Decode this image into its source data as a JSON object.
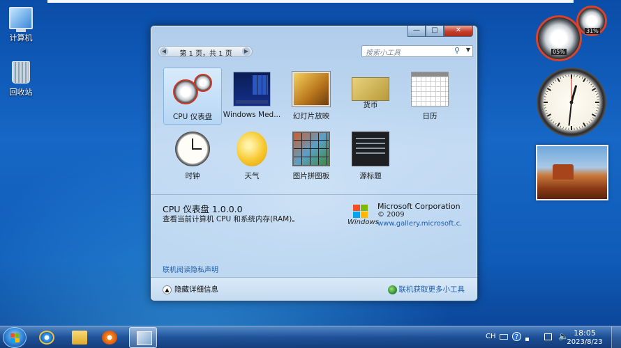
{
  "desktop": {
    "icons": [
      {
        "label": "计算机",
        "icon": "computer-icon"
      },
      {
        "label": "回收站",
        "icon": "recycle-bin-icon"
      }
    ]
  },
  "gadget_window": {
    "pager": {
      "text": "第 1 页，共 1 页",
      "prev": "◀",
      "next": "▶"
    },
    "search": {
      "placeholder": "搜索小工具",
      "icon": "search-icon"
    },
    "gadgets": [
      {
        "label": "CPU 仪表盘",
        "selected": true
      },
      {
        "label": "Windows Med...",
        "selected": false
      },
      {
        "label": "幻灯片放映",
        "selected": false
      },
      {
        "label": "货币",
        "selected": false
      },
      {
        "label": "日历",
        "selected": false
      },
      {
        "label": "时钟",
        "selected": false
      },
      {
        "label": "天气",
        "selected": false
      },
      {
        "label": "图片拼图板",
        "selected": false
      },
      {
        "label": "源标题",
        "selected": false
      }
    ],
    "details": {
      "title": "CPU 仪表盘 1.0.0.0",
      "description": "查看当前计算机 CPU 和系统内存(RAM)。",
      "publisher": "Microsoft Corporation",
      "year": "© 2009",
      "url": "www.gallery.microsoft.c...",
      "logo_text": "Windows"
    },
    "privacy_link": "联机阅读隐私声明",
    "hide_details": "隐藏详细信息",
    "more_online": "联机获取更多小工具",
    "controls": {
      "minimize": "—",
      "maximize": "□",
      "close": "✕"
    }
  },
  "sidebar_gadgets": {
    "cpu_meter": {
      "cpu": "05%",
      "memory": "31%"
    },
    "clock": {
      "hour": 12,
      "minute": 31,
      "second": 0
    }
  },
  "taskbar": {
    "pinned": [
      "start-button",
      "internet-explorer",
      "explorer-folder",
      "media-player",
      "desktop-gadgets"
    ],
    "tray": {
      "lang": "CH",
      "help": "?"
    },
    "time": "18:05",
    "date": "2023/8/23"
  },
  "colors": {
    "accent": "#1f5fae",
    "close_red": "#c3402d",
    "taskbar": "#1e5096"
  }
}
